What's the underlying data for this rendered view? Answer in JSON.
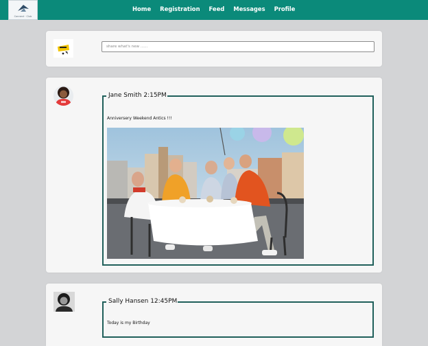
{
  "app": {
    "logo_text": "Connect · Club"
  },
  "nav": {
    "items": [
      "Home",
      "Registration",
      "Feed",
      "Messages",
      "Profile"
    ]
  },
  "composer": {
    "placeholder": "share what's new ......"
  },
  "posts": [
    {
      "author": "Jane Smith",
      "time": "2:15PM",
      "header": "Jane Smith 2:15PM",
      "text": "Anniversery Weekend Antics !!!",
      "has_photo": true
    },
    {
      "author": "Sally Hansen",
      "time": "12:45PM",
      "header": "Sally Hansen 12:45PM",
      "text": "Today is my Birthday",
      "has_photo": false
    }
  ],
  "colors": {
    "topbar": "#0b8a7a",
    "post_border": "#1f5f5a",
    "page_bg": "#d3d4d6",
    "card_bg": "#f6f6f6"
  }
}
